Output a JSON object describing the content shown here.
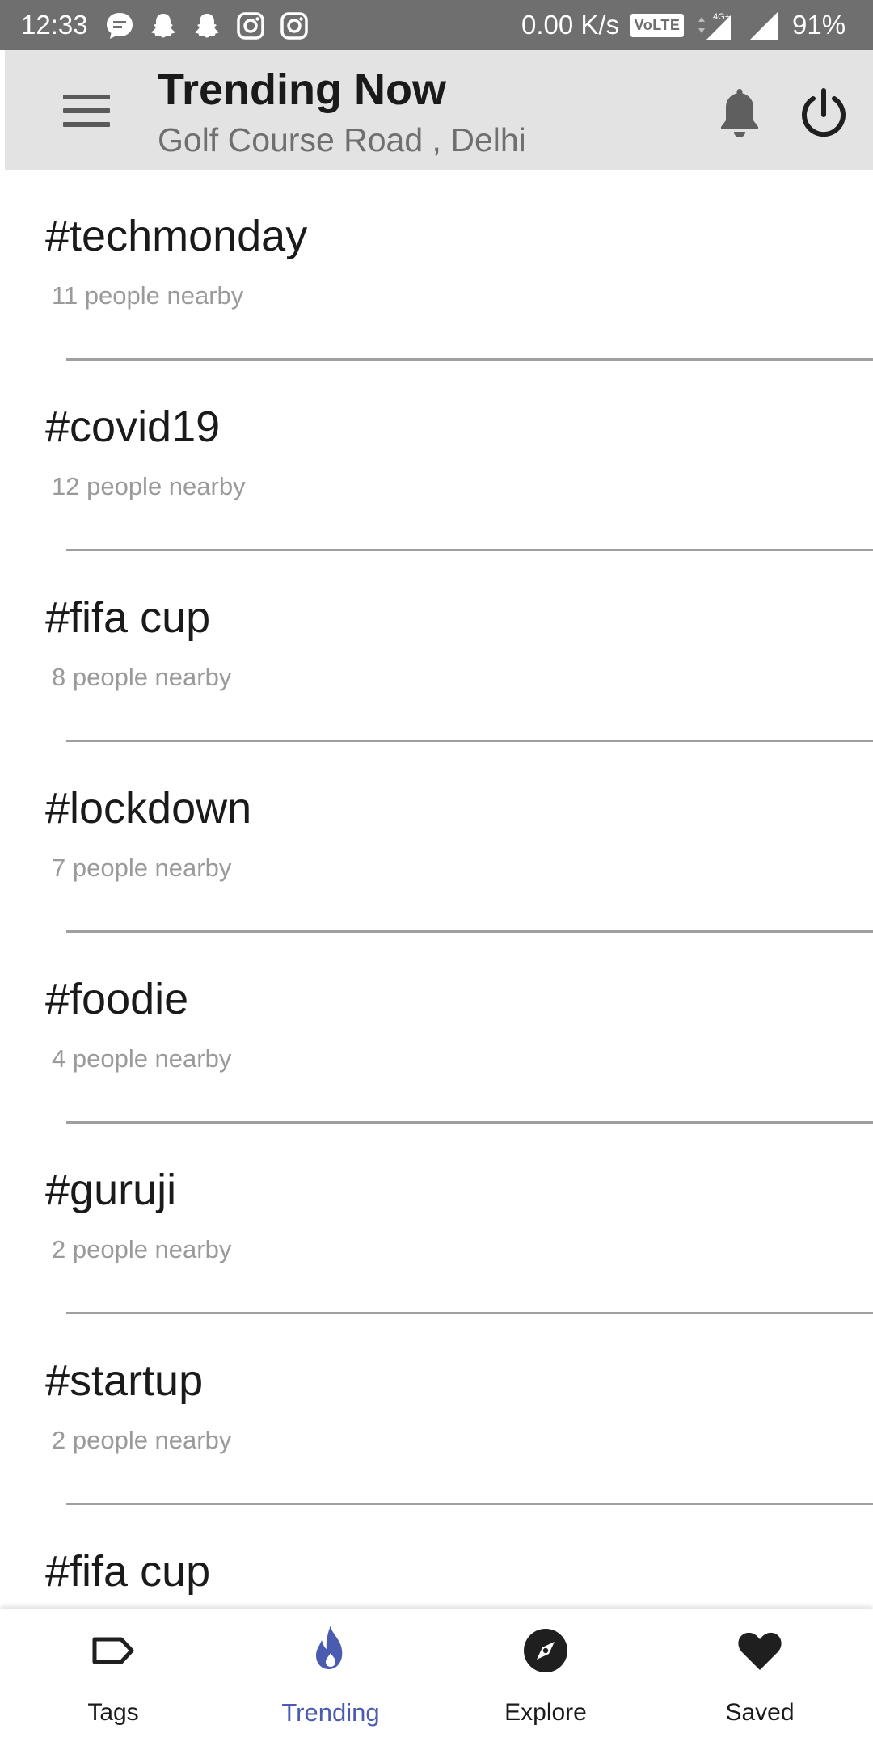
{
  "status_bar": {
    "time": "12:33",
    "network_speed": "0.00 K/s",
    "volte_label": "VoLTE",
    "network_type": "4G+",
    "battery": "91%",
    "notification_icons": [
      "message-icon",
      "snapchat-icon",
      "snapchat-icon",
      "instagram-icon",
      "instagram-icon"
    ]
  },
  "header": {
    "title": "Trending Now",
    "subtitle": "Golf Course Road , Delhi",
    "menu_icon": "hamburger-menu-icon",
    "bell_icon": "bell-icon",
    "power_icon": "power-icon"
  },
  "trending": {
    "items": [
      {
        "tag": "#techmonday",
        "count": "11 people nearby"
      },
      {
        "tag": "#covid19",
        "count": "12 people nearby"
      },
      {
        "tag": "#fifa cup",
        "count": "8 people nearby"
      },
      {
        "tag": "#lockdown",
        "count": "7 people nearby"
      },
      {
        "tag": "#foodie",
        "count": "4 people nearby"
      },
      {
        "tag": "#guruji",
        "count": "2 people nearby"
      },
      {
        "tag": "#startup",
        "count": "2 people nearby"
      },
      {
        "tag": "#fifa cup",
        "count": ""
      }
    ]
  },
  "bottom_nav": {
    "tags": {
      "label": "Tags",
      "icon": "tag-icon"
    },
    "trending": {
      "label": "Trending",
      "icon": "flame-icon"
    },
    "explore": {
      "label": "Explore",
      "icon": "compass-icon"
    },
    "saved": {
      "label": "Saved",
      "icon": "heart-icon"
    },
    "active": "trending"
  },
  "colors": {
    "status_bar_bg": "#6f6f6f",
    "header_bg": "#e3e3e3",
    "accent": "#4b5bb0",
    "secondary_text": "#9a9a9a",
    "divider": "#a19e9e"
  }
}
